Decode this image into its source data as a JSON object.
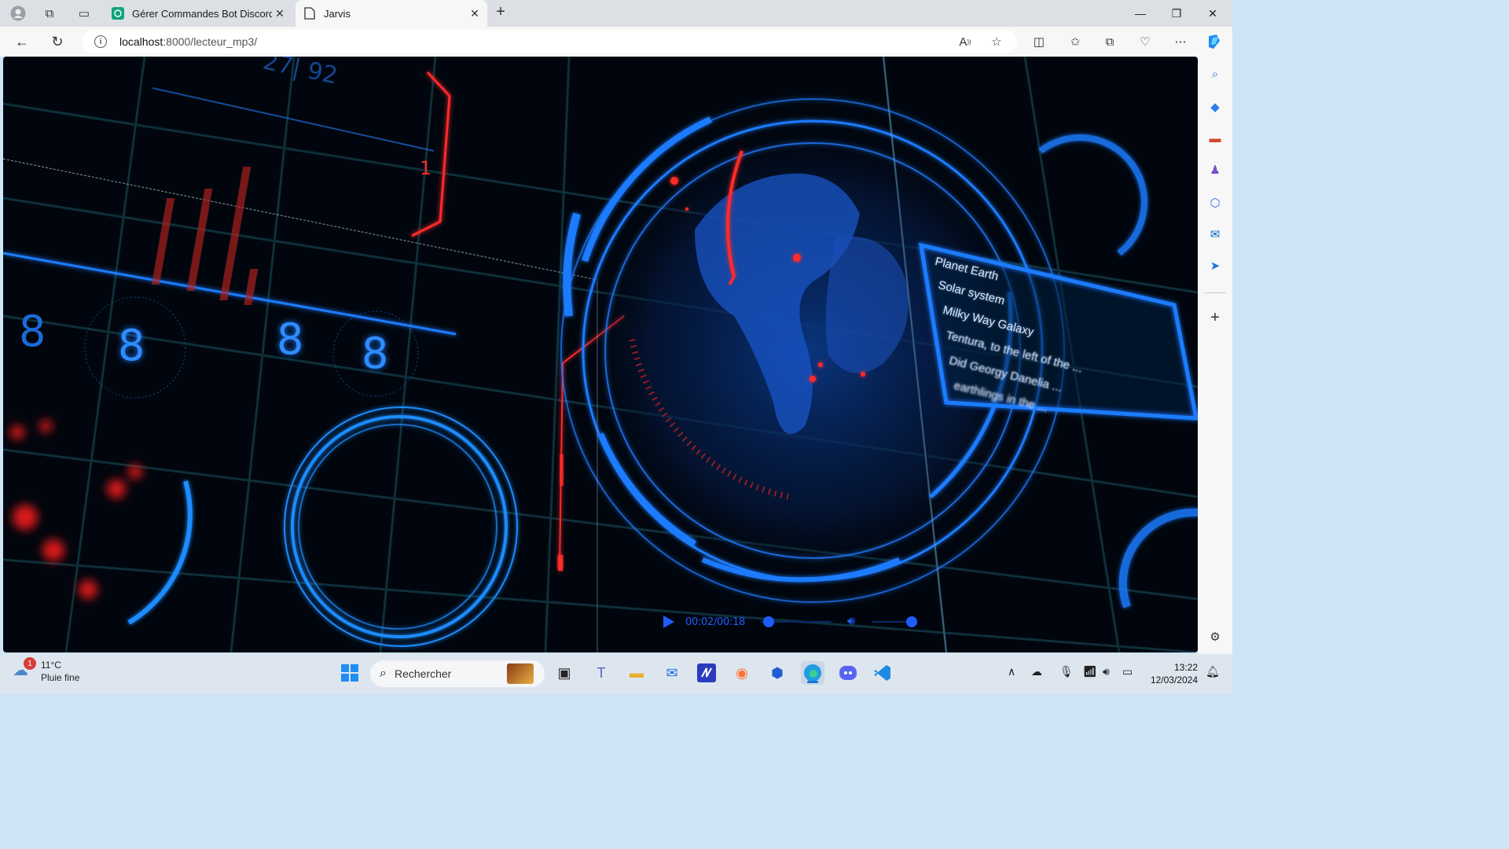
{
  "browser": {
    "tabs": [
      {
        "title": "Gérer Commandes Bot Discord",
        "active": false
      },
      {
        "title": "Jarvis",
        "active": true
      }
    ],
    "url_host": "localhost",
    "url_rest": ":8000/lecteur_mp3/"
  },
  "hud": {
    "digits": [
      "8",
      "8",
      "8",
      "8"
    ],
    "small_number_1": "1",
    "top_numbers": "27| 92",
    "info_lines": [
      "Planet Earth",
      "Solar system",
      "Milky Way Galaxy",
      "Tentura, to the left of the ...",
      "Did Georgy Danelia ...",
      "earthlings in the ..."
    ]
  },
  "player": {
    "current_time": "00:02",
    "duration": "00:18",
    "time_display": "00:02/00:18",
    "progress_fraction": 0.11,
    "volume_fraction": 1.0
  },
  "taskbar": {
    "weather_temp": "11°C",
    "weather_desc": "Pluie fine",
    "weather_badge": "1",
    "search_placeholder": "Rechercher",
    "time": "13:22",
    "date": "12/03/2024"
  },
  "colors": {
    "accent": "#1f5cff",
    "hud_blue": "#1e7bff",
    "hud_red": "#ff2a2a",
    "background": "#01060e"
  }
}
